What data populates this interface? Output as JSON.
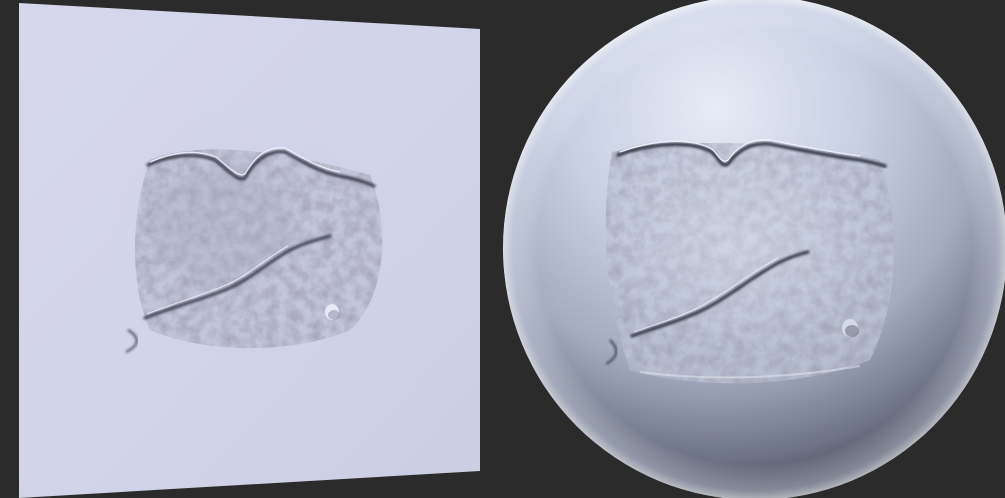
{
  "scene": {
    "background_color": "#2b2b2b",
    "objects": [
      {
        "name": "flat-plane-preview",
        "material_color": "#d3d4ea"
      },
      {
        "name": "sphere-preview",
        "material_color": "#c9cede"
      }
    ],
    "detail": "cracked-peeling-surface-alpha"
  }
}
